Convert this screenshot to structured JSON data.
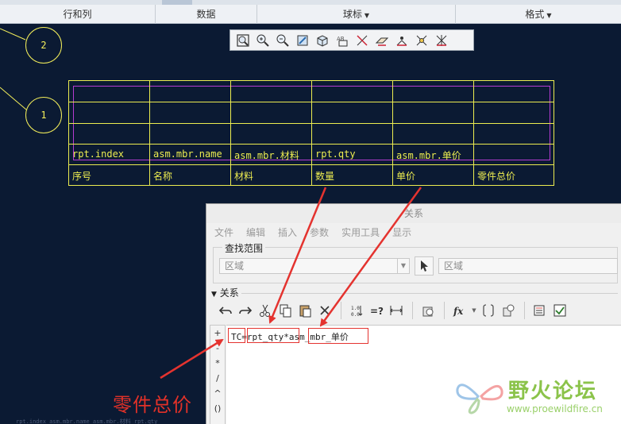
{
  "ribbon": {
    "groups": [
      {
        "label": "行和列",
        "has_menu": false
      },
      {
        "label": "数据",
        "has_menu": false
      },
      {
        "label": "球标",
        "has_menu": true
      },
      {
        "label": "格式",
        "has_menu": true
      }
    ]
  },
  "mini_toolbar": {
    "icons": [
      "refit-icon",
      "zoom-in-icon",
      "zoom-out-icon",
      "repaint-icon",
      "view-orient-icon",
      "annotation-display-icon",
      "datum-axis-icon",
      "datum-plane-icon",
      "datum-point-icon",
      "csys-icon",
      "spin-center-icon"
    ]
  },
  "balloons": [
    {
      "label": "2"
    },
    {
      "label": "1"
    }
  ],
  "table": {
    "parameter_row": [
      "rpt.index",
      "asm.mbr.name",
      "asm.mbr.材料",
      "rpt.qty",
      "asm.mbr.单价",
      ""
    ],
    "header_row": [
      "序号",
      "名称",
      "材料",
      "数量",
      "单价",
      "零件总价"
    ]
  },
  "dialog": {
    "title": "关系",
    "menu": [
      "文件",
      "编辑",
      "插入",
      "参数",
      "实用工具",
      "显示"
    ],
    "search_scope": {
      "label": "查找范围",
      "scope_value": "区域",
      "pick_value": "区域"
    },
    "relations_label": "关系",
    "toolbar_icons": [
      "undo-icon",
      "redo-icon",
      "cut-icon",
      "copy-icon",
      "paste-icon",
      "delete-icon",
      "sort-relations-icon",
      "evaluate-icon",
      "insert-dimension-icon",
      "verify-icon",
      "function-icon",
      "parameters-icon",
      "locally-defined-icon",
      "show-dimensions-icon",
      "check-icon"
    ],
    "side_operators": [
      "+",
      "-",
      "*",
      "/",
      "^",
      "()"
    ],
    "relation_text": {
      "lhs": "TC",
      "op1": "=",
      "term1": "rpt_qty",
      "op2": "*",
      "term2": "asm_mbr_单价"
    }
  },
  "callout": {
    "text": "零件总价"
  },
  "faint_text": "rpt.index  asm.mbr.name  asm.mbr.材料  rpt.qty",
  "watermark": {
    "name": "野火论坛",
    "url": "www.proewildfire.cn"
  },
  "colors": {
    "background": "#0b1a33",
    "table_line": "#ecec50",
    "region": "#b43bd2",
    "arrow": "#e4332f"
  }
}
